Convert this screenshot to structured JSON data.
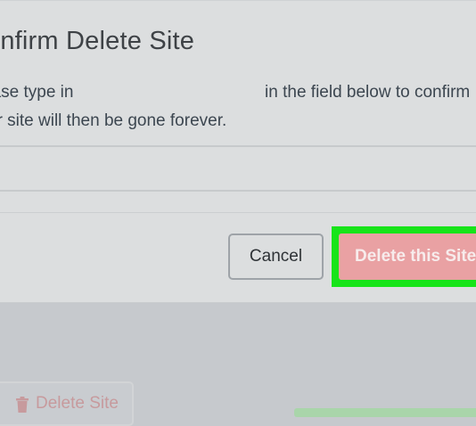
{
  "dialog": {
    "title": "onfirm Delete Site",
    "instruction_before": "ease type in",
    "instruction_after": "in the field below to confirm",
    "instruction_line2": "ur site will then be gone forever.",
    "confirm_field": {
      "value": "",
      "placeholder": ""
    },
    "cancel_label": "Cancel",
    "delete_label": "Delete this Site"
  },
  "background": {
    "delete_site_label": "Delete Site",
    "delete_icon": "trash-icon"
  },
  "colors": {
    "highlight": "#18e41a",
    "danger": "#e9a1a3",
    "overlay": "#dcdedf"
  }
}
